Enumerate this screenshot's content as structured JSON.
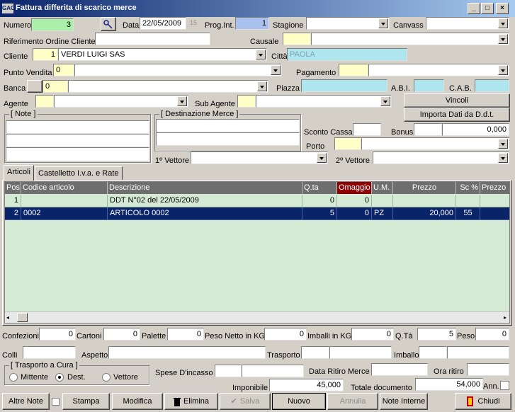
{
  "window": {
    "title": "Fattura differita di scarico merce",
    "app_badge": "GAC"
  },
  "header": {
    "numero_label": "Numero",
    "numero_value": "3",
    "data_label": "Data",
    "data_value": "22/05/2009",
    "calendar_day": "15",
    "prog_label": "Prog.Int.",
    "prog_value": "1",
    "stagione_label": "Stagione",
    "stagione_value": "",
    "canvass_label": "Canvass",
    "canvass_value": "",
    "rif_label": "Riferimento Ordine Cliente",
    "rif_value": "",
    "causale_label": "Causale",
    "causale_value": "",
    "cliente_label": "Cliente",
    "cliente_code": "1",
    "cliente_name": "VERDI LUIGI SAS",
    "citta_label": "Città",
    "citta_value": "PAOLA",
    "pv_label": "Punto Vendita",
    "pv_code": "0",
    "pv_name": "",
    "pagamento_label": "Pagamento",
    "pagamento_value": "",
    "banca_label": "Banca",
    "banca_code": "0",
    "banca_name": "",
    "piazza_label": "Piazza",
    "piazza_value": "",
    "abi_label": "A.B.I.",
    "abi_value": "",
    "cab_label": "C.A.B.",
    "cab_value": "",
    "agente_label": "Agente",
    "agente_value": "",
    "subagente_label": "Sub Agente",
    "subagente_value": "",
    "vincoli_label": "Vincoli",
    "importa_label": "Importa Dati da D.d.t.",
    "note_label": "Note",
    "dest_label": "Destinazione Merce",
    "sconto_label": "Sconto Cassa",
    "sconto_value": "",
    "bonus_label": "Bonus",
    "bonus_value": "",
    "bonus_amount": "0,000",
    "porto_label": "Porto",
    "porto_value": "",
    "vettore1_label": "1º Vettore",
    "vettore1_value": "",
    "vettore2_label": "2º Vettore",
    "vettore2_value": ""
  },
  "tabs": [
    {
      "label": "Articoli"
    },
    {
      "label": "Castelletto I.v.a. e Rate"
    }
  ],
  "grid": {
    "columns": [
      "Pos",
      "Codice articolo",
      "Descrizione",
      "Q.ta",
      "Omaggio",
      "U.M.",
      "Prezzo",
      "Sc %",
      "Prezzo"
    ],
    "rows": [
      {
        "pos": "1",
        "codice": "",
        "descrizione": "DDT N°02 del 22/05/2009",
        "qta": "0",
        "omaggio": "0",
        "um": "",
        "prezzo": "",
        "sc": "",
        "prezzo2": ""
      },
      {
        "pos": "2",
        "codice": "0002",
        "descrizione": "ARTICOLO 0002",
        "qta": "5",
        "omaggio": "0",
        "um": "PZ",
        "prezzo": "20,000",
        "sc": "55",
        "prezzo2": ""
      }
    ]
  },
  "footer": {
    "confezioni_label": "Confezioni",
    "confezioni_value": "0",
    "cartoni_label": "Cartoni",
    "cartoni_value": "0",
    "palette_label": "Palette",
    "palette_value": "0",
    "peso_netto_label": "Peso Netto in KG",
    "peso_netto_value": "0",
    "imballi_label": "Imballi in KG",
    "imballi_value": "0",
    "qta_label": "Q.Tà",
    "qta_value": "5",
    "peso_label": "Peso",
    "peso_value": "0",
    "colli_label": "Colli",
    "colli_value": "",
    "aspetto_label": "Aspetto",
    "aspetto_value": "",
    "trasporto_label": "Trasporto",
    "trasporto_value": "",
    "imballo_label": "Imballo",
    "imballo_value": "",
    "trasporto_cura_label": "Trasporto a Cura",
    "radio_mittente": "Mittente",
    "radio_dest": "Dest.",
    "radio_vettore": "Vettore",
    "spese_label": "Spese D'incasso",
    "spese_value": "",
    "data_ritiro_label": "Data Ritiro Merce",
    "data_ritiro_value": "",
    "ora_ritiro_label": "Ora ritiro",
    "ora_ritiro_value": "",
    "imponibile_label": "Imponibile",
    "imponibile_value": "45,000",
    "totale_label": "Totale documento",
    "totale_value": "54,000",
    "ann_label": "Ann."
  },
  "buttons": {
    "altre_note": "Altre Note",
    "stampa": "Stampa",
    "modifica": "Modifica",
    "elimina": "Elimina",
    "salva": "Salva",
    "nuovo": "Nuovo",
    "annulla": "Annulla",
    "note_interne": "Note Interne",
    "chiudi": "Chiudi"
  },
  "colors": {
    "title_start": "#0a246a",
    "title_end": "#a6caf0",
    "grid_bg": "#d4ead4",
    "selected_row": "#0a246a",
    "omaggio_header": "#8b0000"
  }
}
